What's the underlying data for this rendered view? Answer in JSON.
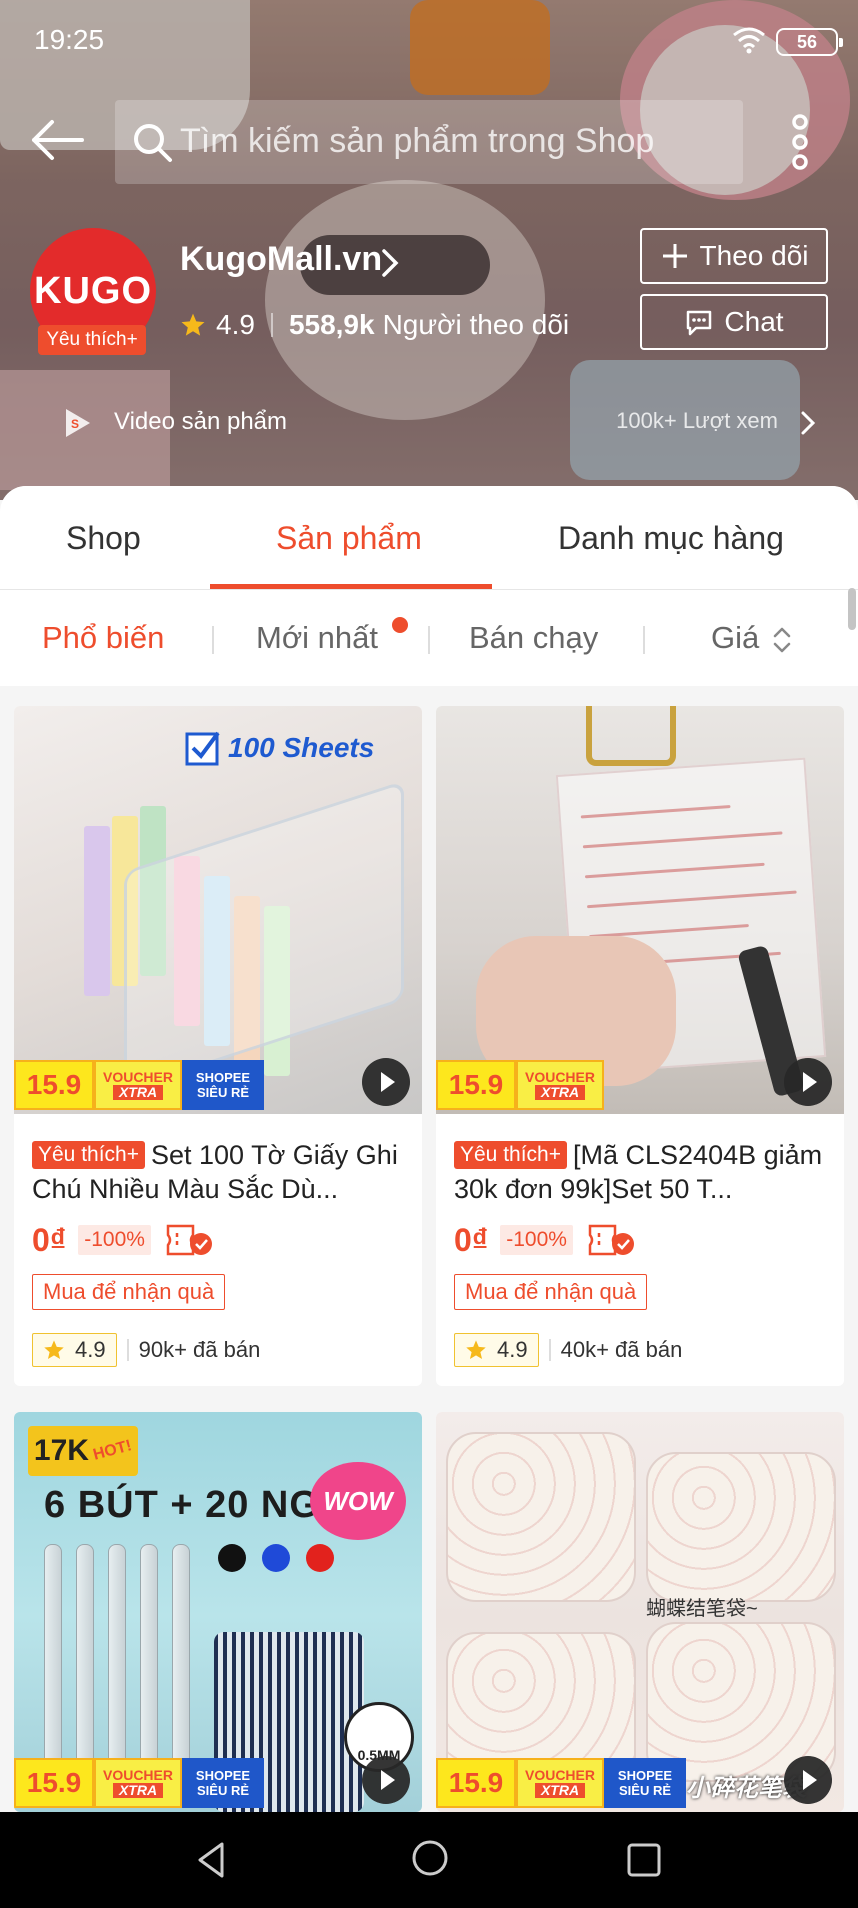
{
  "status_bar": {
    "time": "19:25",
    "battery": "56"
  },
  "search": {
    "placeholder": "Tìm kiếm sản phẩm trong Shop"
  },
  "shop": {
    "logo_text": "KUGO",
    "badge": "Yêu thích+",
    "name": "KugoMall.vn",
    "rating": "4.9",
    "followers": "558,9k",
    "followers_label": "Người theo dõi",
    "follow_label": "Theo dõi",
    "chat_label": "Chat"
  },
  "video_bar": {
    "label": "Video sản phẩm",
    "views": "100k+ Lượt xem"
  },
  "tabs": [
    {
      "label": "Shop"
    },
    {
      "label": "Sản phẩm"
    },
    {
      "label": "Danh mục hàng"
    }
  ],
  "sort": [
    {
      "label": "Phổ biến"
    },
    {
      "label": "Mới nhất"
    },
    {
      "label": "Bán chạy"
    },
    {
      "label": "Giá"
    }
  ],
  "products": [
    {
      "fav_tag": "Yêu thích+",
      "title": "Set 100 Tờ Giấy Ghi Chú Nhiều Màu Sắc Dù...",
      "price": "0₫",
      "discount": "-100%",
      "gift": "Mua để nhận quà",
      "rating": "4.9",
      "sold": "90k+ đã bán",
      "image_text": "100 Sheets"
    },
    {
      "fav_tag": "Yêu thích+",
      "title": "[Mã CLS2404B giảm 30k đơn 99k]Set 50 T...",
      "price": "0₫",
      "discount": "-100%",
      "gift": "Mua để nhận quà",
      "rating": "4.9",
      "sold": "40k+ đã bán"
    },
    {
      "image_text": {
        "price_tag": "17K",
        "hot": "HOT!",
        "headline": "6 BÚT + 20 NGÒI",
        "wow": "WOW",
        "size": "0.5MM"
      }
    },
    {
      "image_text": {
        "caption": "蝴蝶结笔袋~",
        "brand": "小碎花笔袋"
      }
    }
  ],
  "badges": {
    "price": "15.9",
    "voucher_top": "VOUCHER",
    "voucher_bottom": "XTRA",
    "sieure_top": "SHOPEE",
    "sieure_bottom": "SIÊU RẺ"
  },
  "colors": {
    "accent": "#ee4d2d",
    "nav_bg": "#000000"
  }
}
